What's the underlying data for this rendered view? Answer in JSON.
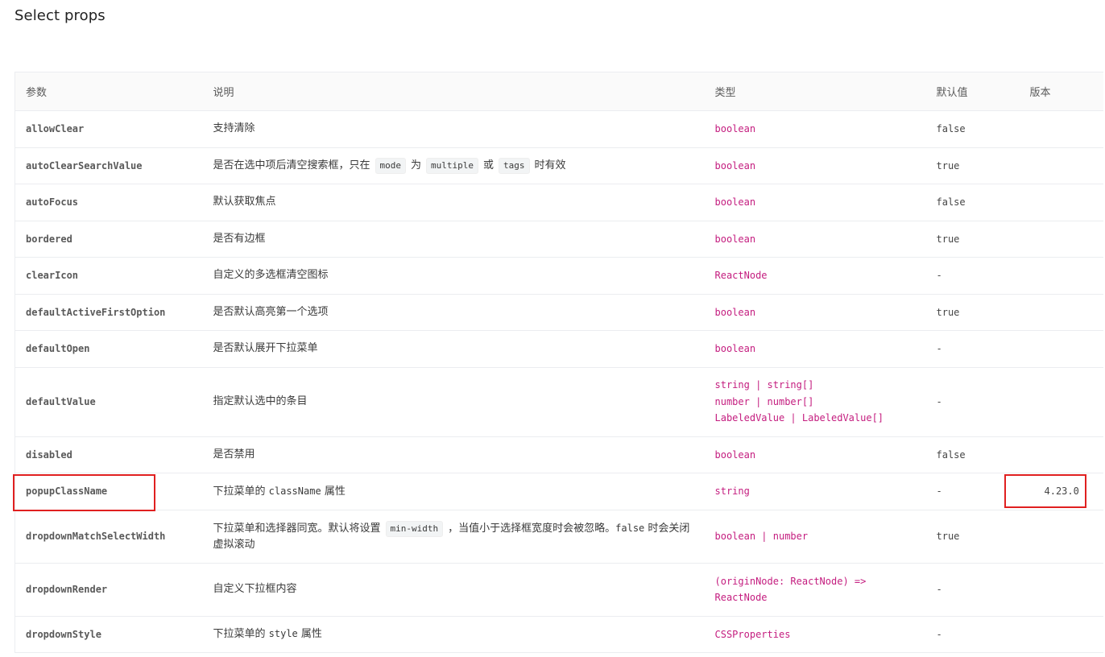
{
  "page": {
    "title": "Select props"
  },
  "table": {
    "headers": {
      "param": "参数",
      "desc": "说明",
      "type": "类型",
      "default": "默认值",
      "version": "版本"
    },
    "rows": [
      {
        "param": "allowClear",
        "desc": "支持清除",
        "type": "boolean",
        "default": "false",
        "version": ""
      },
      {
        "param": "autoClearSearchValue",
        "desc_parts": [
          "是否在选中项后清空搜索框，只在",
          "mode",
          "为",
          "multiple",
          "或",
          "tags",
          "时有效"
        ],
        "type": "boolean",
        "default": "true",
        "version": ""
      },
      {
        "param": "autoFocus",
        "desc": "默认获取焦点",
        "type": "boolean",
        "default": "false",
        "version": ""
      },
      {
        "param": "bordered",
        "desc": "是否有边框",
        "type": "boolean",
        "default": "true",
        "version": ""
      },
      {
        "param": "clearIcon",
        "desc": "自定义的多选框清空图标",
        "type": "ReactNode",
        "default": "-",
        "version": ""
      },
      {
        "param": "defaultActiveFirstOption",
        "desc": "是否默认高亮第一个选项",
        "type": "boolean",
        "default": "true",
        "version": ""
      },
      {
        "param": "defaultOpen",
        "desc": "是否默认展开下拉菜单",
        "type": "boolean",
        "default": "-",
        "version": ""
      },
      {
        "param": "defaultValue",
        "desc": "指定默认选中的条目",
        "type_lines": [
          "string | string[]",
          "number | number[]",
          "LabeledValue | LabeledValue[]"
        ],
        "default": "-",
        "version": ""
      },
      {
        "param": "disabled",
        "desc": "是否禁用",
        "type": "boolean",
        "default": "false",
        "version": ""
      },
      {
        "param": "popupClassName",
        "desc_parts": [
          "下拉菜单的",
          "className",
          "属性"
        ],
        "type": "string",
        "default": "-",
        "version": "4.23.0"
      },
      {
        "param": "dropdownMatchSelectWidth",
        "desc_parts": [
          "下拉菜单和选择器同宽。默认将设置",
          "min-width",
          "，当值小于选择框宽度时会被忽略。",
          "false",
          "时会关闭虚拟滚动"
        ],
        "type": "boolean | number",
        "default": "true",
        "version": ""
      },
      {
        "param": "dropdownRender",
        "desc": "自定义下拉框内容",
        "type_lines": [
          "(originNode: ReactNode) =>",
          "ReactNode"
        ],
        "default": "-",
        "version": ""
      },
      {
        "param": "dropdownStyle",
        "desc_parts": [
          "下拉菜单的",
          "style",
          "属性"
        ],
        "type": "CSSProperties",
        "default": "-",
        "version": ""
      }
    ]
  },
  "colors": {
    "type_text": "#c41d7f",
    "highlight_border": "#e02020",
    "header_bg": "#fafafa",
    "row_border": "#ebedf0"
  }
}
